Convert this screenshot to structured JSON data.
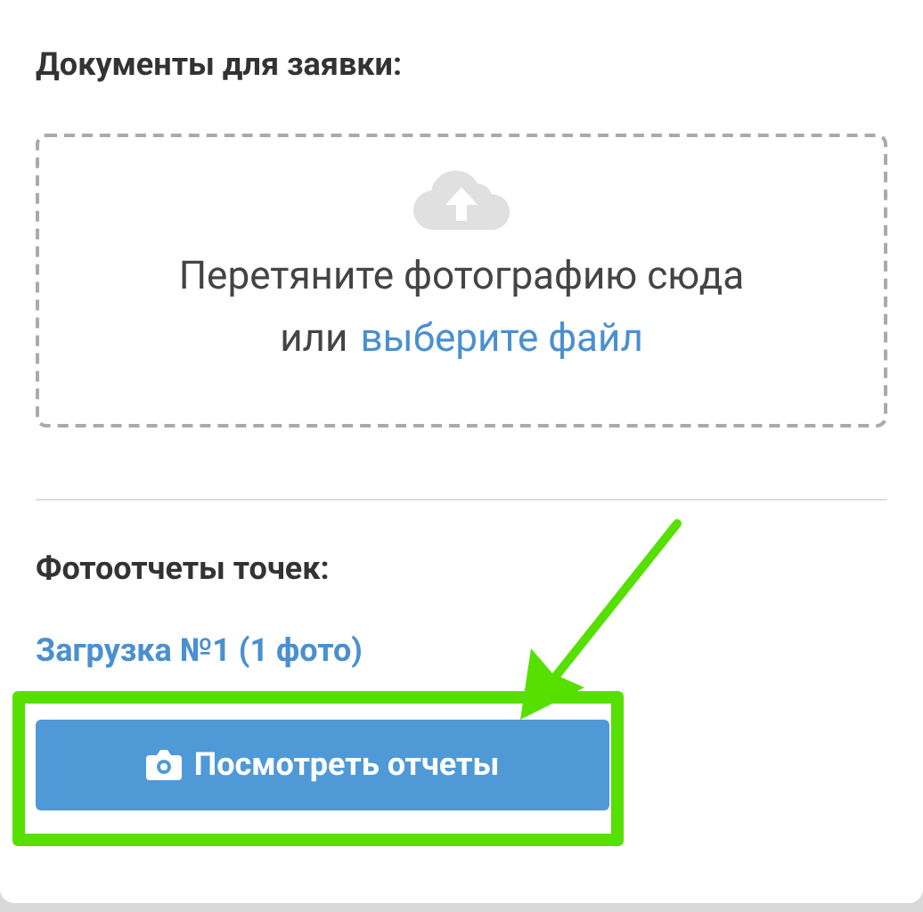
{
  "documents": {
    "heading": "Документы для заявки:",
    "dropzone": {
      "text": "Перетяните фотографию сюда",
      "prefix": "или",
      "link": "выберите файл"
    }
  },
  "reports": {
    "heading": "Фотоотчеты точек:",
    "upload_link": "Загрузка №1 (1 фото)",
    "button": "Посмотреть отчеты"
  }
}
